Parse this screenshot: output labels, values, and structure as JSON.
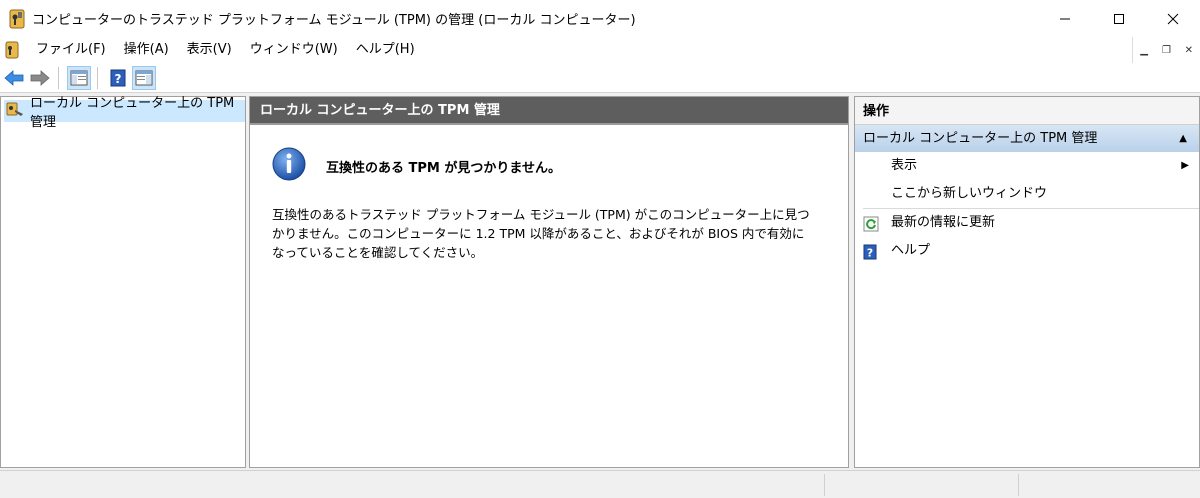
{
  "window": {
    "title": "コンピューターのトラステッド プラットフォーム モジュール (TPM) の管理 (ローカル コンピューター)",
    "icon": "tpm-key-icon",
    "controls": [
      "minimize-icon",
      "maximize-icon",
      "close-icon"
    ]
  },
  "menu": {
    "items": [
      {
        "label": "ファイル(F)"
      },
      {
        "label": "操作(A)"
      },
      {
        "label": "表示(V)"
      },
      {
        "label": "ウィンドウ(W)"
      },
      {
        "label": "ヘルプ(H)"
      }
    ],
    "mdi_controls": [
      "mdi-minimize-icon",
      "mdi-restore-icon",
      "mdi-close-icon"
    ]
  },
  "toolbar": {
    "buttons": [
      "back-arrow-icon",
      "forward-arrow-icon",
      "show-hide-console-tree-icon",
      "help-icon",
      "show-hide-action-pane-icon"
    ]
  },
  "tree": {
    "items": [
      {
        "label": "ローカル コンピューター上の TPM 管理",
        "icon": "tpm-snapin-icon"
      }
    ]
  },
  "center": {
    "header": "ローカル コンピューター上の TPM 管理",
    "info_icon": "info-icon",
    "info_title": "互換性のある TPM が見つかりません。",
    "info_body": "互換性のあるトラステッド プラットフォーム モジュール (TPM) がこのコンピューター上に見つかりません。このコンピューターに 1.2 TPM 以降があること、およびそれが BIOS 内で有効になっていることを確認してください。"
  },
  "actions": {
    "header": "操作",
    "group": "ローカル コンピューター上の TPM 管理",
    "items": [
      {
        "label": "表示",
        "has_submenu": true
      },
      {
        "label": "ここから新しいウィンドウ"
      },
      {
        "label": "最新の情報に更新",
        "icon": "refresh-icon"
      },
      {
        "label": "ヘルプ",
        "icon": "help-icon"
      }
    ]
  },
  "colors": {
    "selection": "#cce8ff",
    "center_header_bg": "#5e5e5e",
    "actions_group_bg": "#c6d9ee",
    "accent_blue": "#3a7dd1"
  }
}
